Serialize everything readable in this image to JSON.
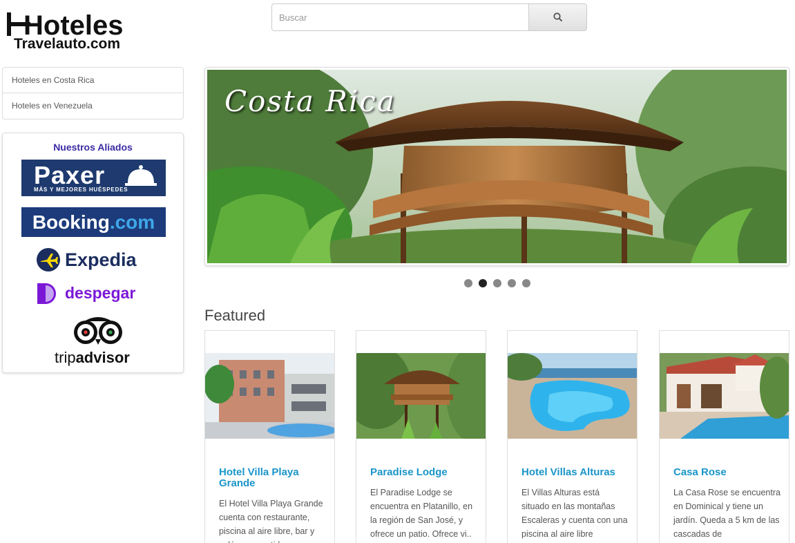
{
  "logo": {
    "line1": "Hoteles",
    "line2": "Travelauto.com"
  },
  "search": {
    "placeholder": "Buscar"
  },
  "sidebar": {
    "items": [
      {
        "label": "Hoteles en Costa Rica"
      },
      {
        "label": "Hoteles en Venezuela"
      }
    ]
  },
  "allies": {
    "title": "Nuestros Aliados",
    "paxer": {
      "name": "Paxer",
      "tagline": "MÁS Y MEJORES HUÉSPEDES"
    },
    "booking": {
      "name": "Booking",
      "suffix": ".com"
    },
    "expedia": {
      "name": "Expedia"
    },
    "despegar": {
      "name": "despegar"
    },
    "tripadvisor": {
      "name_a": "trip",
      "name_b": "advisor"
    }
  },
  "hero": {
    "title": "Costa Rica"
  },
  "carousel": {
    "count": 5,
    "active_index": 1
  },
  "featured": {
    "title": "Featured",
    "cards": [
      {
        "name": "Hotel Villa Playa Grande",
        "desc": "El Hotel Villa Playa Grande cuenta con restaurante, piscina al aire libre, bar y salón compartido en"
      },
      {
        "name": "Paradise Lodge",
        "desc": "El Paradise Lodge se encuentra en Platanillo, en la región de San José, y ofrece un patio. Ofrece vi.."
      },
      {
        "name": "Hotel Villas Alturas",
        "desc": "El Villas Alturas está situado en las montañas Escaleras y cuenta con una piscina al aire libre"
      },
      {
        "name": "Casa Rose",
        "desc": "La Casa Rose se encuentra en Dominical y tiene un jardín. Queda a 5 km de las cascadas de"
      }
    ]
  },
  "colors": {
    "link": "#1a95c9",
    "allies_title": "#3a2aa3",
    "paxer_bg": "#1e3a6e",
    "booking_bg": "#1d3b7a",
    "despegar": "#7b18d6"
  }
}
